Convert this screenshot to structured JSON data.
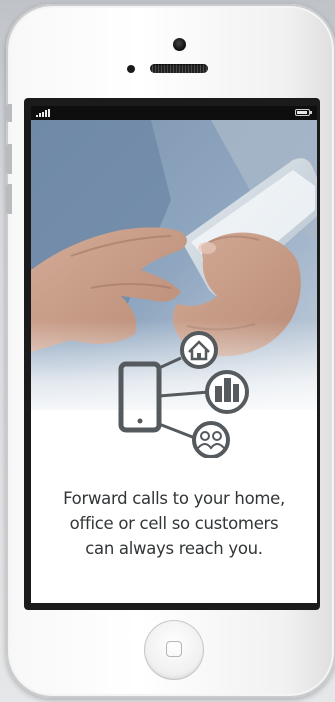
{
  "device": {
    "type": "smartphone",
    "color": "#ffffff",
    "screen_bezel_color": "#1b1b1b"
  },
  "status_bar": {
    "signal_icon": "signal-bars-icon",
    "battery_icon": "battery-icon"
  },
  "screen": {
    "hero_image": "hands-holding-phone-photo",
    "diagram": {
      "center_icon": "mobile-phone-icon",
      "branches": [
        "home-icon",
        "office-building-icon",
        "people-icon"
      ]
    },
    "caption_lines": [
      "Forward calls to your home,",
      "office or cell so customers",
      "can always reach you."
    ],
    "text_color": "#333638",
    "icon_color": "#555a5e"
  },
  "hardware": {
    "home_button_icon": "home-button-square-icon"
  }
}
